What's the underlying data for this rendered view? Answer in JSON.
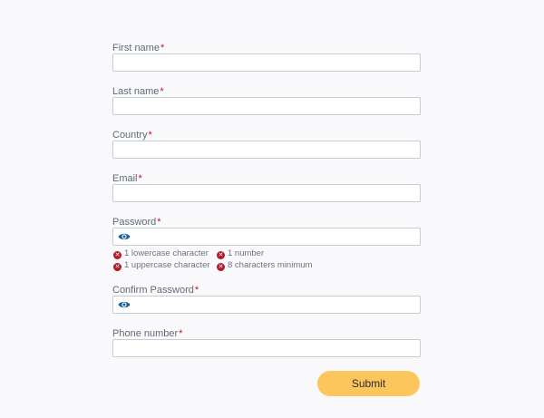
{
  "form": {
    "required_marker": "*",
    "fields": {
      "first_name": {
        "label": "First name",
        "value": ""
      },
      "last_name": {
        "label": "Last name",
        "value": ""
      },
      "country": {
        "label": "Country",
        "value": ""
      },
      "email": {
        "label": "Email",
        "value": ""
      },
      "password": {
        "label": "Password",
        "value": ""
      },
      "confirm_password": {
        "label": "Confirm Password",
        "value": ""
      },
      "phone": {
        "label": "Phone number",
        "value": ""
      }
    },
    "password_rules": {
      "lowercase": "1 lowercase character",
      "uppercase": "1 uppercase character",
      "number": "1 number",
      "min_length": "8 characters minimum",
      "status_icon": "x-circle-icon",
      "status_color": "#b5172b"
    },
    "submit_label": "Submit"
  },
  "colors": {
    "accent_button": "#fcc65c",
    "eye_icon": "#1b5f96",
    "required": "#c8102e"
  }
}
